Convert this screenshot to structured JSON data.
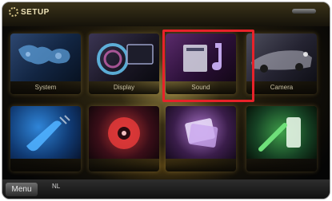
{
  "header": {
    "title": "SETUP"
  },
  "tiles": [
    {
      "label": "System"
    },
    {
      "label": "Display"
    },
    {
      "label": "Sound"
    },
    {
      "label": "Camera"
    },
    {
      "label": ""
    },
    {
      "label": ""
    },
    {
      "label": ""
    },
    {
      "label": ""
    }
  ],
  "footer": {
    "menu_label": "Menu",
    "hint": "NL"
  },
  "highlight_color": "#e8222a"
}
